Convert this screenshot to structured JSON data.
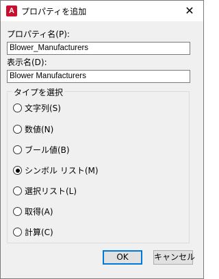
{
  "window": {
    "title": "プロパティを追加",
    "close_glyph": "✕"
  },
  "property_name": {
    "label": "プロパティ名(P):",
    "value": "Blower_Manufacturers"
  },
  "display_name": {
    "label": "表示名(D):",
    "value": "Blower Manufacturers"
  },
  "type_group": {
    "caption": "タイプを選択",
    "options": [
      {
        "label": "文字列(S)",
        "selected": false
      },
      {
        "label": "数値(N)",
        "selected": false
      },
      {
        "label": "ブール値(B)",
        "selected": false
      },
      {
        "label": "シンボル リスト(M)",
        "selected": true
      },
      {
        "label": "選択リスト(L)",
        "selected": false
      },
      {
        "label": "取得(A)",
        "selected": false
      },
      {
        "label": "計算(C)",
        "selected": false
      }
    ]
  },
  "buttons": {
    "ok": "OK",
    "cancel": "キャンセル"
  }
}
